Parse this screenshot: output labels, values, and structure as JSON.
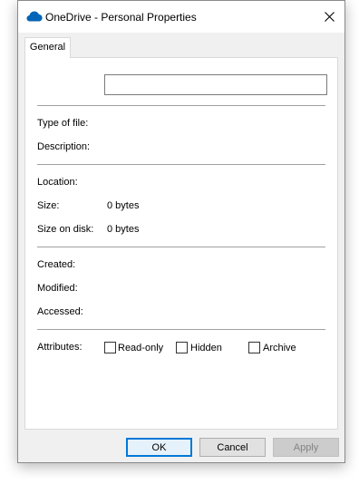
{
  "window": {
    "title": "OneDrive - Personal Properties",
    "icon": "onedrive-cloud-icon",
    "close_glyph": "✕"
  },
  "tabs": [
    {
      "label": "General",
      "selected": true
    }
  ],
  "general": {
    "name_value": "",
    "type_of_file": {
      "label": "Type of file:",
      "value": ""
    },
    "description": {
      "label": "Description:",
      "value": ""
    },
    "location": {
      "label": "Location:",
      "value": ""
    },
    "size": {
      "label": "Size:",
      "value": "0 bytes"
    },
    "size_on_disk": {
      "label": "Size on disk:",
      "value": "0 bytes"
    },
    "created": {
      "label": "Created:",
      "value": ""
    },
    "modified": {
      "label": "Modified:",
      "value": ""
    },
    "accessed": {
      "label": "Accessed:",
      "value": ""
    },
    "attributes": {
      "label": "Attributes:",
      "read_only": {
        "label": "Read-only",
        "checked": false
      },
      "hidden": {
        "label": "Hidden",
        "checked": false
      },
      "archive": {
        "label": "Archive",
        "checked": false
      }
    }
  },
  "buttons": {
    "ok": "OK",
    "cancel": "Cancel",
    "apply": "Apply"
  },
  "colors": {
    "accent": "#0078d7",
    "onedrive_blue": "#0364b8"
  }
}
